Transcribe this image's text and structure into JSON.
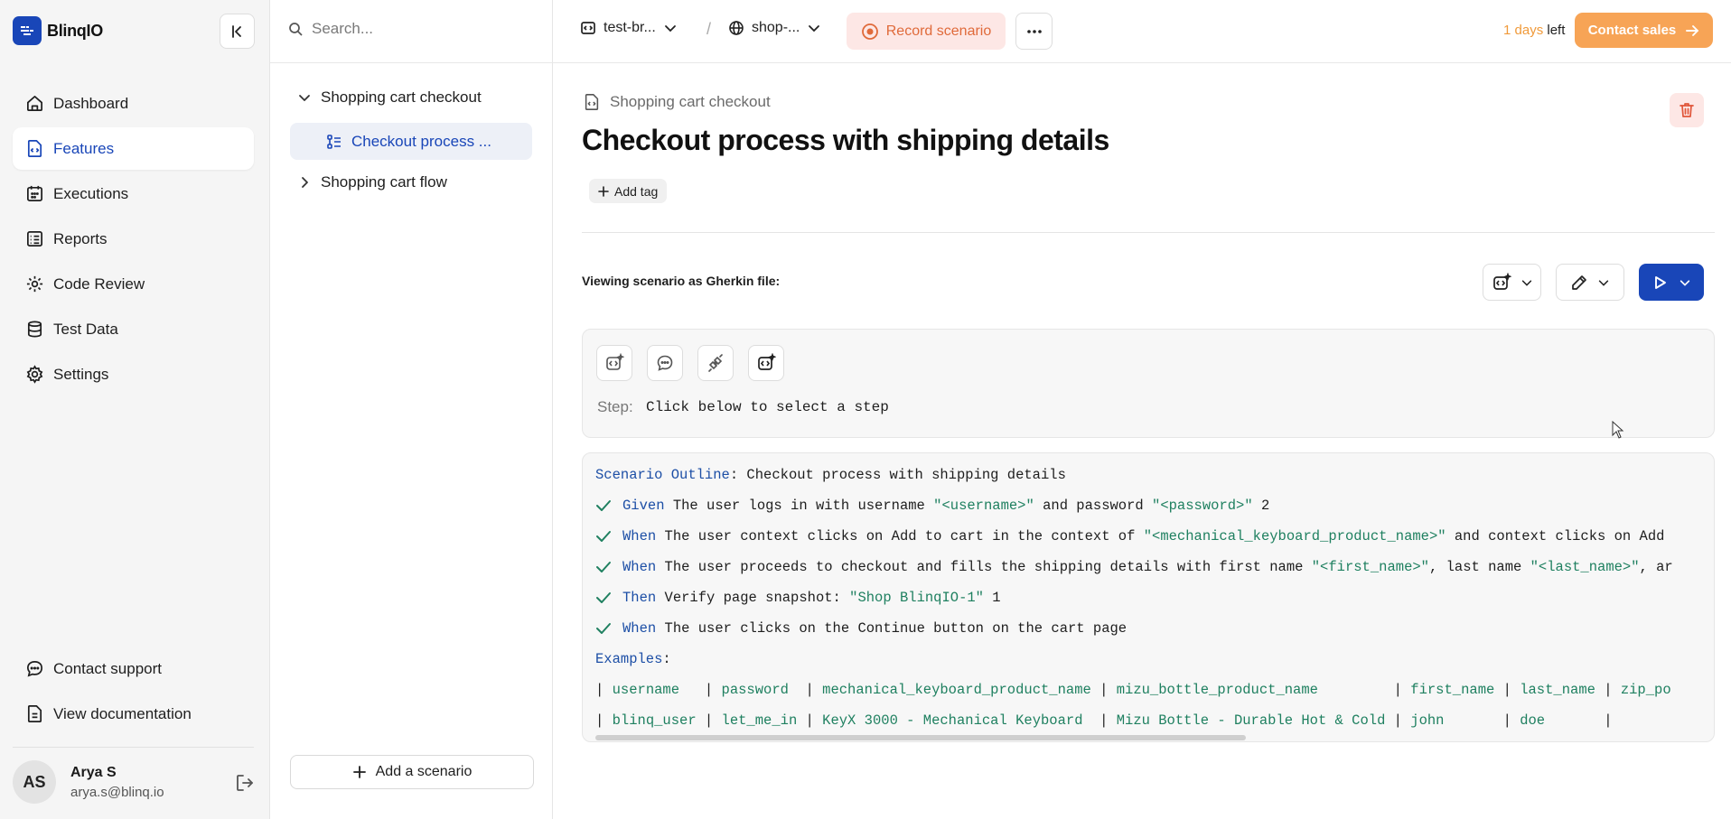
{
  "brand": {
    "name": "BlinqIO"
  },
  "nav": {
    "items": [
      {
        "label": "Dashboard",
        "icon": "home-icon"
      },
      {
        "label": "Features",
        "icon": "feature-file-icon",
        "active": true
      },
      {
        "label": "Executions",
        "icon": "calendar-grid-icon"
      },
      {
        "label": "Reports",
        "icon": "report-list-icon"
      },
      {
        "label": "Code Review",
        "icon": "code-gear-icon"
      },
      {
        "label": "Test Data",
        "icon": "database-icon"
      },
      {
        "label": "Settings",
        "icon": "gear-icon"
      }
    ],
    "bottom": [
      {
        "label": "Contact support",
        "icon": "chat-bubble-icon"
      },
      {
        "label": "View documentation",
        "icon": "document-icon"
      }
    ]
  },
  "user": {
    "initials": "AS",
    "name": "Arya S",
    "email": "arya.s@blinq.io"
  },
  "tree": {
    "search_placeholder": "Search...",
    "items": [
      {
        "label": "Shopping cart checkout",
        "expanded": true
      },
      {
        "label": "Checkout process ...",
        "selected": true
      },
      {
        "label": "Shopping cart flow",
        "expanded": false
      }
    ],
    "add_scenario": "Add a scenario"
  },
  "topbar": {
    "project": "test-br...",
    "environment": "shop-...",
    "separator": "/",
    "record": "Record scenario",
    "trial_days": "1 days",
    "trial_suffix": " left",
    "contact_sales": "Contact sales"
  },
  "feature": {
    "breadcrumb": "Shopping cart checkout",
    "title": "Checkout process with shipping details",
    "add_tag": "Add tag"
  },
  "viewer": {
    "label": "Viewing scenario as Gherkin file:",
    "step_label": "Step:",
    "step_value": "Click below to select a step"
  },
  "gherkin": {
    "header_keyword": "Scenario Outline",
    "header_text": ": Checkout process with shipping details",
    "steps": [
      {
        "keyword": "Given",
        "parts": [
          " The user logs in with username ",
          "\"<username>\"",
          " and password ",
          "\"<password>\"",
          " 2"
        ]
      },
      {
        "keyword": "When",
        "parts": [
          " The user context clicks on Add to cart in the context of ",
          "\"<mechanical_keyboard_product_name>\"",
          " and context clicks on Add"
        ]
      },
      {
        "keyword": "When",
        "parts": [
          " The user proceeds to checkout and fills the shipping details with first name ",
          "\"<first_name>\"",
          ", last name ",
          "\"<last_name>\"",
          ", ar"
        ]
      },
      {
        "keyword": "Then",
        "parts": [
          " Verify page snapshot: ",
          "\"Shop BlinqIO-1\"",
          " 1"
        ]
      },
      {
        "keyword": "When",
        "parts": [
          " The user clicks on the Continue button on the cart page"
        ]
      }
    ],
    "examples_keyword": "Examples",
    "examples_colon": ":",
    "table_header": [
      "username  ",
      "password ",
      "mechanical_keyboard_product_name",
      "mizu_bottle_product_name        ",
      "first_name",
      "last_name",
      "zip_po"
    ],
    "table_row": [
      "blinq_user",
      "let_me_in",
      "KeyX 3000 - Mechanical Keyboard ",
      "Mizu Bottle - Durable Hot & Cold",
      "john      ",
      "doe      ",
      ""
    ]
  },
  "colors": {
    "accent": "#1946b8",
    "orange": "#f7a456",
    "record": "#e06a3a",
    "green": "#1f8060"
  }
}
